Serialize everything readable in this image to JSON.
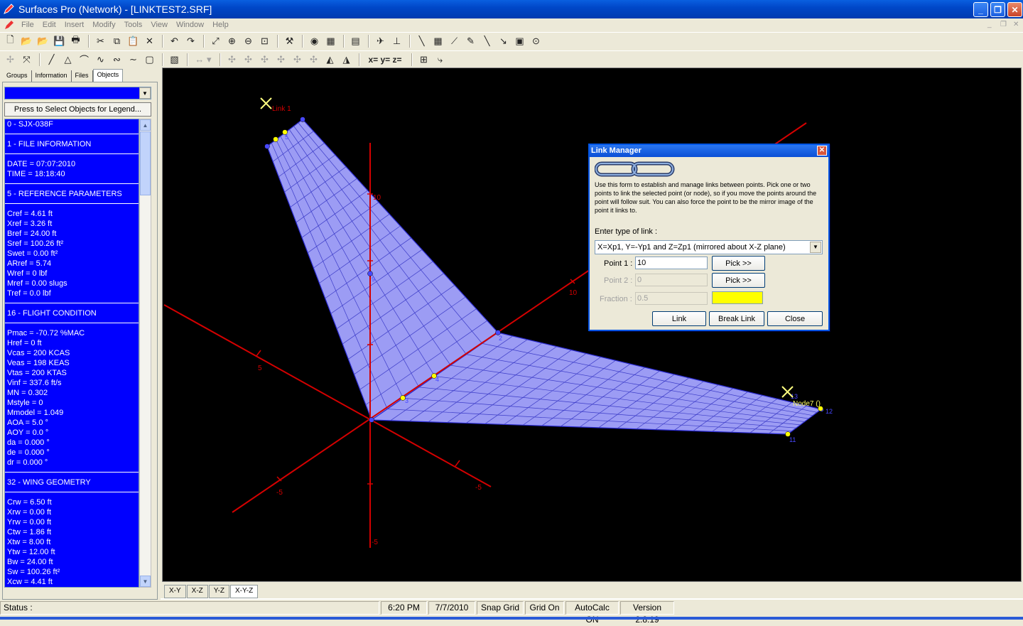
{
  "window": {
    "title": "Surfaces Pro (Network) - [LINKTEST2.SRF]"
  },
  "menu": [
    "File",
    "Edit",
    "Insert",
    "Modify",
    "Tools",
    "View",
    "Window",
    "Help"
  ],
  "panel": {
    "tabs": [
      "Groups",
      "Information",
      "Files",
      "Objects"
    ],
    "active_tab": "Objects",
    "legend_button": "Press to Select Objects for Legend...",
    "list_items": [
      "0 - SJX-038F",
      "|",
      "1 - FILE INFORMATION",
      "|",
      "DATE = 07:07:2010",
      "TIME = 18:18:40",
      "|",
      "5 - REFERENCE PARAMETERS",
      "|",
      "Cref = 4.61 ft",
      "Xref = 3.26 ft",
      "Bref = 24.00 ft",
      "Sref = 100.26 ft²",
      "Swet = 0.00 ft²",
      "ARref = 5.74",
      "Wref = 0 lbf",
      "Mref = 0.00 slugs",
      "Tref = 0.0 lbf",
      "|",
      "16 - FLIGHT CONDITION",
      "|",
      "Pmac = -70.72 %MAC",
      "Href = 0 ft",
      "Vcas = 200 KCAS",
      "Veas = 198 KEAS",
      "Vtas = 200 KTAS",
      "Vinf = 337.6 ft/s",
      "MN = 0.302",
      "Mstyle = 0",
      "Mmodel = 1.049",
      "AOA = 5.0 °",
      "AOY = 0.0 °",
      "da = 0.000 °",
      "de = 0.000 °",
      "dr = 0.000 °",
      "|",
      "32 - WING GEOMETRY",
      "|",
      "Crw = 6.50 ft",
      "Xrw = 0.00 ft",
      "Yrw = 0.00 ft",
      "Ctw = 1.86 ft",
      "Xtw = 8.00 ft",
      "Ytw = 12.00 ft",
      "Bw = 24.00 ft",
      "Sw = 100.26 ft²",
      "Xcw = 4.41 ft"
    ]
  },
  "viewport": {
    "labels": {
      "link1": "Link 1",
      "node7": "Node7 ()",
      "axis_10_z": "10",
      "axis_10_y": "10",
      "axis_5_x": "5",
      "axis_m5_a": "-5",
      "axis_m5_b": "-5",
      "axis_m5_c": "-5",
      "pt2": "2",
      "pt3": "3",
      "pt4": "4",
      "pt5": "5",
      "pt9": "9",
      "pt11": "11",
      "pt12": "12",
      "pt13": "13"
    },
    "tabs": [
      "X-Y",
      "X-Z",
      "Y-Z",
      "X-Y-Z"
    ],
    "active_tab": "X-Y-Z"
  },
  "dialog": {
    "title": "Link Manager",
    "description": "Use this form to establish and manage links between points. Pick one or two points to link the selected point (or node), so if you move the points around the point will follow suit. You can also force the point to be the mirror image of the point it links to.",
    "link_type_label": "Enter type of link :",
    "link_type_value": "X=Xp1, Y=-Yp1 and Z=Zp1 (mirrored about X-Z plane)",
    "point1_label": "Point 1 :",
    "point1_value": "10",
    "point2_label": "Point 2 :",
    "point2_value": "0",
    "fraction_label": "Fraction :",
    "fraction_value": "0.5",
    "pick_label": "Pick >>",
    "link_button": "Link",
    "break_link_button": "Break Link",
    "close_button": "Close",
    "color_swatch": "#ffff00"
  },
  "status": {
    "status_label": "Status :",
    "time": "6:20 PM",
    "date": "7/7/2010",
    "snap": "Snap Grid",
    "grid": "Grid On",
    "autocalc": "AutoCalc ON",
    "version": "Version 2.8.19"
  },
  "colors": {
    "list_bg": "#0000ff",
    "viewport_bg": "#000000",
    "surface": "#9c9cf4",
    "axis": "#d40000",
    "title_blue": "#0047c8"
  }
}
